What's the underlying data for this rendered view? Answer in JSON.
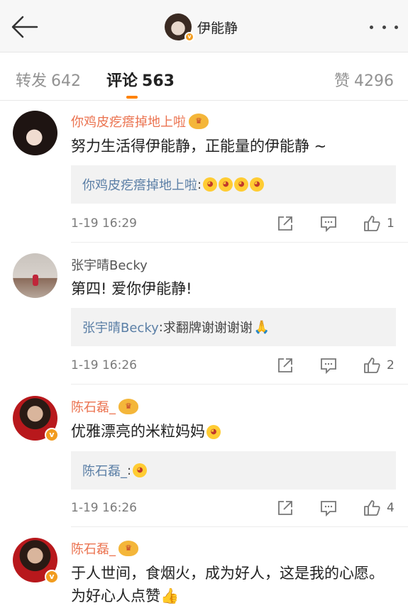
{
  "header": {
    "title": "伊能静",
    "back_icon": "arrow-left-icon",
    "more_icon": "more-dots-icon"
  },
  "tabs": {
    "repost": {
      "label": "转发",
      "count": "642"
    },
    "comment": {
      "label": "评论",
      "count": "563"
    },
    "like": {
      "label": "赞",
      "count": "4296"
    },
    "accent": "#ff8200"
  },
  "comments": [
    {
      "user": "你鸡皮疙瘩掉地上啦",
      "text": "努力生活得伊能静，正能量的伊能静 ~",
      "reply_user": "你鸡皮疙瘩掉地上啦",
      "reply_sep": ":",
      "reply_text": "",
      "time": "1-19 16:29",
      "likes": "1"
    },
    {
      "user": "张宇晴Becky",
      "text": "第四! 爱你伊能静!",
      "reply_user": "张宇晴Becky",
      "reply_sep": ":",
      "reply_text": " 求翻牌谢谢谢谢",
      "time": "1-19 16:26",
      "likes": "2"
    },
    {
      "user": "陈石磊_",
      "text": "优雅漂亮的米粒妈妈",
      "reply_user": "陈石磊_",
      "reply_sep": ":",
      "reply_text": "",
      "time": "1-19 16:26",
      "likes": "4"
    },
    {
      "user": "陈石磊_",
      "text": "于人世间，食烟火，成为好人，这是我的心愿。为好心人点赞"
    }
  ],
  "colors": {
    "username": "#eb7350",
    "reply_name": "#5b7fa6",
    "header_bg": "#f7f7f7"
  }
}
